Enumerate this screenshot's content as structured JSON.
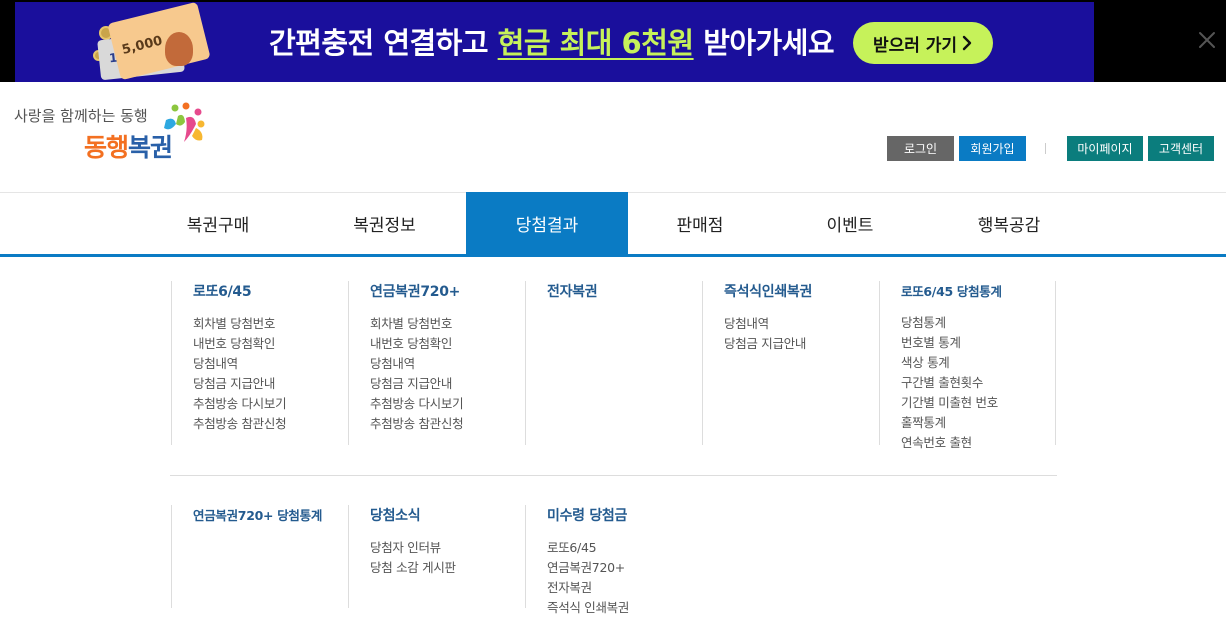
{
  "banner": {
    "ticket_amount_front": "5,000",
    "ticket_amount_back": "1,000",
    "text_before": "간편충전 연결하고 ",
    "text_highlight": "현금 최대 6천원",
    "text_after": " 받아가세요",
    "button_label": "받으러 가기",
    "button_icon": "chevron-right-icon",
    "close_icon": "close-icon",
    "bg_color": "#1a0f9c",
    "accent_color": "#c6f25a"
  },
  "header": {
    "slogan": "사랑을 함께하는 동행",
    "logo_part1": "동행",
    "logo_part2": "복권",
    "logo_icon": "lottery-logo-mark-icon"
  },
  "utility": {
    "login": "로그인",
    "join": "회원가입",
    "mypage": "마이페이지",
    "customer_center": "고객센터"
  },
  "gnb": {
    "items": [
      "복권구매",
      "복권정보",
      "당첨결과",
      "판매점",
      "이벤트",
      "행복공감"
    ],
    "active_index": 2,
    "active_color": "#0a7bc4"
  },
  "menu": {
    "row1": [
      {
        "title": "로또6/45",
        "items": [
          "회차별 당첨번호",
          "내번호 당첨확인",
          "당첨내역",
          "당첨금 지급안내",
          "추첨방송 다시보기",
          "추첨방송 참관신청"
        ]
      },
      {
        "title": "연금복권720+",
        "items": [
          "회차별 당첨번호",
          "내번호 당첨확인",
          "당첨내역",
          "당첨금 지급안내",
          "추첨방송 다시보기",
          "추첨방송 참관신청"
        ]
      },
      {
        "title": "전자복권",
        "items": []
      },
      {
        "title": "즉석식인쇄복권",
        "items": [
          "당첨내역",
          "당첨금 지급안내"
        ]
      },
      {
        "title": "로또6/45 당첨통계",
        "items": [
          "당첨통계",
          "번호별 통계",
          "색상 통계",
          "구간별 출현횟수",
          "기간별 미출현 번호",
          "홀짝통계",
          "연속번호 출현"
        ]
      }
    ],
    "row2": [
      {
        "title": "연금복권720+ 당첨통계",
        "items": []
      },
      {
        "title": "당첨소식",
        "items": [
          "당첨자 인터뷰",
          "당첨 소감 게시판"
        ]
      },
      {
        "title": "미수령 당첨금",
        "items": [
          "로또6/45",
          "연금복권720+",
          "전자복권",
          "즉석식 인쇄복권"
        ]
      }
    ]
  }
}
